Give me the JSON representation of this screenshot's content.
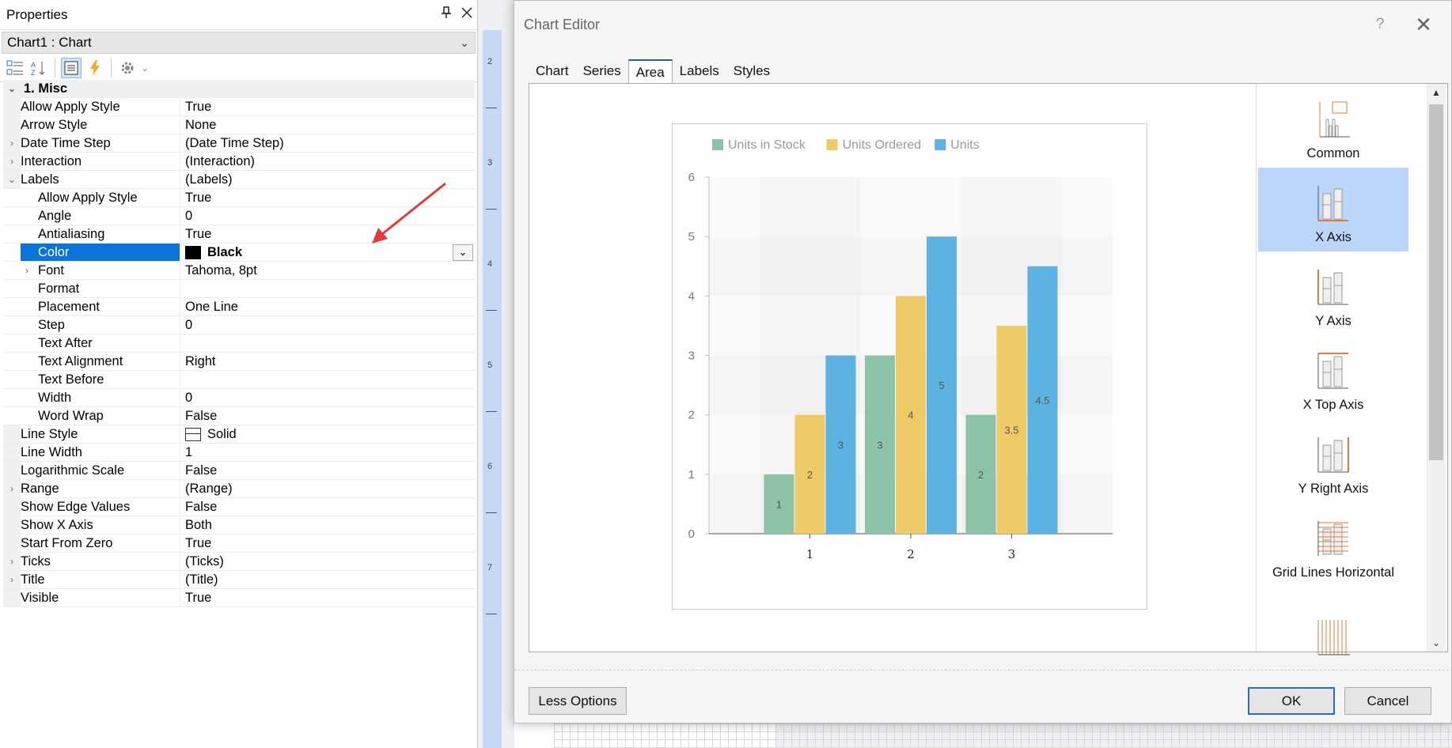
{
  "properties": {
    "title": "Properties",
    "object_selector": "Chart1 : Chart",
    "category": "1. Misc",
    "rows": [
      {
        "name": "Allow Apply Style",
        "value": "True",
        "indent": 0,
        "expander": ""
      },
      {
        "name": "Arrow Style",
        "value": "None",
        "indent": 0,
        "expander": ""
      },
      {
        "name": "Date Time Step",
        "value": "(Date Time Step)",
        "indent": 0,
        "expander": "›"
      },
      {
        "name": "Interaction",
        "value": "(Interaction)",
        "indent": 0,
        "expander": "›"
      },
      {
        "name": "Labels",
        "value": "(Labels)",
        "indent": 0,
        "expander": "⌄"
      },
      {
        "name": "Allow Apply Style",
        "value": "True",
        "indent": 1,
        "expander": ""
      },
      {
        "name": "Angle",
        "value": "0",
        "indent": 1,
        "expander": ""
      },
      {
        "name": "Antialiasing",
        "value": "True",
        "indent": 1,
        "expander": ""
      },
      {
        "name": "Color",
        "value": "Black",
        "indent": 1,
        "expander": "",
        "selected": true,
        "swatch": "#000000"
      },
      {
        "name": "Font",
        "value": "Tahoma, 8pt",
        "indent": 1,
        "expander": "›"
      },
      {
        "name": "Format",
        "value": "",
        "indent": 1,
        "expander": ""
      },
      {
        "name": "Placement",
        "value": "One Line",
        "indent": 1,
        "expander": ""
      },
      {
        "name": "Step",
        "value": "0",
        "indent": 1,
        "expander": ""
      },
      {
        "name": "Text After",
        "value": "",
        "indent": 1,
        "expander": ""
      },
      {
        "name": "Text Alignment",
        "value": "Right",
        "indent": 1,
        "expander": ""
      },
      {
        "name": "Text Before",
        "value": "",
        "indent": 1,
        "expander": ""
      },
      {
        "name": "Width",
        "value": "0",
        "indent": 1,
        "expander": ""
      },
      {
        "name": "Word Wrap",
        "value": "False",
        "indent": 1,
        "expander": ""
      },
      {
        "name": "Line Style",
        "value": "Solid",
        "indent": 0,
        "expander": "",
        "lineicon": true
      },
      {
        "name": "Line Width",
        "value": "1",
        "indent": 0,
        "expander": ""
      },
      {
        "name": "Logarithmic Scale",
        "value": "False",
        "indent": 0,
        "expander": ""
      },
      {
        "name": "Range",
        "value": "(Range)",
        "indent": 0,
        "expander": "›"
      },
      {
        "name": "Show Edge Values",
        "value": "False",
        "indent": 0,
        "expander": ""
      },
      {
        "name": "Show X Axis",
        "value": "Both",
        "indent": 0,
        "expander": ""
      },
      {
        "name": "Start From Zero",
        "value": "True",
        "indent": 0,
        "expander": ""
      },
      {
        "name": "Ticks",
        "value": "(Ticks)",
        "indent": 0,
        "expander": "›"
      },
      {
        "name": "Title",
        "value": "(Title)",
        "indent": 0,
        "expander": "›"
      },
      {
        "name": "Visible",
        "value": "True",
        "indent": 0,
        "expander": ""
      }
    ]
  },
  "ruler_numbers": [
    "2",
    "3",
    "4",
    "5",
    "6",
    "7"
  ],
  "dialog": {
    "title": "Chart Editor",
    "help": "?",
    "close": "✕",
    "tabs": [
      "Chart",
      "Series",
      "Area",
      "Labels",
      "Styles"
    ],
    "active_tab": "Area",
    "side_items": [
      {
        "label": "Common",
        "icon": "common-chart-icon",
        "selected": false
      },
      {
        "label": "X Axis",
        "icon": "x-axis-icon",
        "selected": true
      },
      {
        "label": "Y Axis",
        "icon": "y-axis-icon",
        "selected": false
      },
      {
        "label": "X Top Axis",
        "icon": "x-top-axis-icon",
        "selected": false
      },
      {
        "label": "Y Right Axis",
        "icon": "y-right-axis-icon",
        "selected": false
      },
      {
        "label": "Grid Lines Horizontal",
        "icon": "grid-lines-horizontal-icon",
        "selected": false
      },
      {
        "label": "",
        "icon": "grid-lines-vertical-icon",
        "selected": false
      }
    ],
    "less_options": "Less Options",
    "ok": "OK",
    "cancel": "Cancel"
  },
  "colors": {
    "stock": "#8dc3a7",
    "ordered": "#efcb68",
    "units": "#5cb2e0",
    "accent": "#0b74d7"
  },
  "chart_data": {
    "type": "bar",
    "categories": [
      "1",
      "2",
      "3"
    ],
    "series": [
      {
        "name": "Units in Stock",
        "values": [
          1,
          3,
          2
        ],
        "labels": [
          "1",
          "3",
          "2"
        ]
      },
      {
        "name": "Units Ordered",
        "values": [
          2,
          4,
          3.5
        ],
        "labels": [
          "2",
          "4",
          "3.5"
        ]
      },
      {
        "name": "Units",
        "values": [
          3,
          5,
          4.5
        ],
        "labels": [
          "3",
          "5",
          "4.5"
        ]
      }
    ],
    "ylim": [
      0,
      6
    ],
    "yticks": [
      "0",
      "1",
      "2",
      "3",
      "4",
      "5",
      "6"
    ],
    "legend": "top-left"
  }
}
